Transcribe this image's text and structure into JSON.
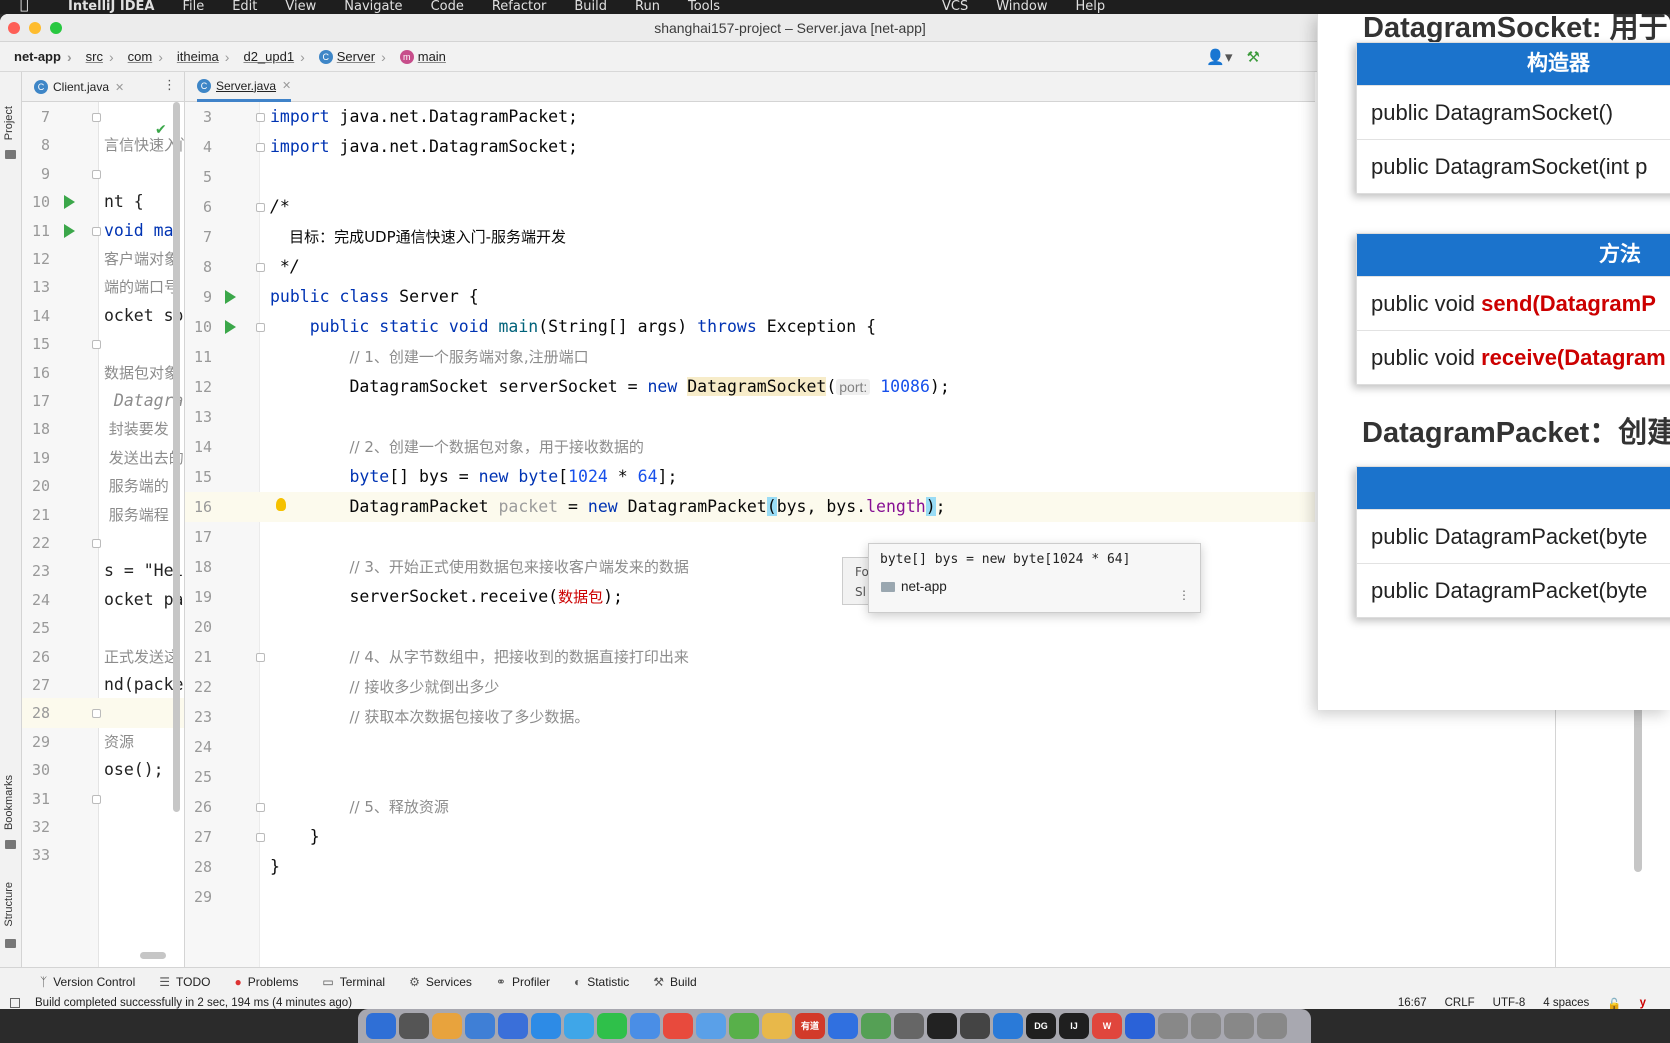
{
  "menubar": {
    "app_name": "IntelliJ IDEA",
    "items": [
      "File",
      "Edit",
      "View",
      "Navigate",
      "Code",
      "Refactor",
      "Build",
      "Run",
      "Tools",
      "VCS",
      "Window",
      "Help"
    ]
  },
  "window": {
    "title": "shanghai157-project – Server.java [net-app]"
  },
  "breadcrumbs": [
    {
      "label": "net-app",
      "icon": ""
    },
    {
      "label": "src",
      "icon": ""
    },
    {
      "label": "com",
      "icon": ""
    },
    {
      "label": "itheima",
      "icon": ""
    },
    {
      "label": "d2_upd1",
      "icon": ""
    },
    {
      "label": "Server",
      "icon": "class-icon"
    },
    {
      "label": "main",
      "icon": "method-icon"
    }
  ],
  "tool_stripe": {
    "project": "Project",
    "bookmarks": "Bookmarks",
    "structure": "Structure"
  },
  "tabs": {
    "left": {
      "label": "Client.java"
    },
    "right": {
      "label": "Server.java"
    }
  },
  "left_editor": {
    "lines": [
      {
        "n": "7",
        "code": ""
      },
      {
        "n": "8",
        "code": "言信快速入门"
      },
      {
        "n": "9",
        "code": ""
      },
      {
        "n": "10",
        "code": "nt {"
      },
      {
        "n": "11",
        "code": "void ma"
      },
      {
        "n": "12",
        "code": "客户端对象"
      },
      {
        "n": "13",
        "code": "端的端口号"
      },
      {
        "n": "14",
        "code": "ocket so"
      },
      {
        "n": "15",
        "code": ""
      },
      {
        "n": "16",
        "code": "数据包对象"
      },
      {
        "n": "17",
        "code": " Datagra"
      },
      {
        "n": "18",
        "code": " 封装要发"
      },
      {
        "n": "19",
        "code": " 发送出去的"
      },
      {
        "n": "20",
        "code": " 服务端的"
      },
      {
        "n": "21",
        "code": " 服务端程"
      },
      {
        "n": "22",
        "code": ""
      },
      {
        "n": "23",
        "code": "s = \"Hel"
      },
      {
        "n": "24",
        "code": "ocket pa"
      },
      {
        "n": "25",
        "code": ""
      },
      {
        "n": "26",
        "code": "正式发送这"
      },
      {
        "n": "27",
        "code": "nd(packe"
      },
      {
        "n": "28",
        "code": ""
      },
      {
        "n": "29",
        "code": "资源"
      },
      {
        "n": "30",
        "code": "ose();"
      },
      {
        "n": "31",
        "code": ""
      },
      {
        "n": "32",
        "code": ""
      },
      {
        "n": "33",
        "code": ""
      }
    ]
  },
  "right_editor": {
    "line_numbers": [
      "3",
      "4",
      "5",
      "6",
      "7",
      "8",
      "9",
      "10",
      "11",
      "12",
      "13",
      "14",
      "15",
      "16",
      "17",
      "18",
      "19",
      "20",
      "21",
      "22",
      "23",
      "24",
      "25",
      "26",
      "27",
      "28",
      "29"
    ],
    "l3": [
      "import",
      " java.net.DatagramPacket;"
    ],
    "l4": [
      "import",
      " java.net.DatagramSocket;"
    ],
    "l6": "/*",
    "l7": "    目标：完成UDP通信快速入门-服务端开发",
    "l8": " */",
    "l9": [
      "public class",
      " Server {"
    ],
    "l10": [
      "public static void",
      " main",
      "(String[] args) ",
      "throws",
      " Exception {"
    ],
    "l11": "// 1、创建一个服务端对象,注册端口",
    "l12": [
      "DatagramSocket serverSocket = ",
      "new",
      " ",
      "DatagramSocket",
      "(",
      "port:",
      " ",
      "10086",
      ");"
    ],
    "l14": "// 2、创建一个数据包对象，用于接收数据的",
    "l15": [
      "byte",
      "[] bys = ",
      "new",
      " ",
      "byte",
      "[",
      "1024",
      " * ",
      "64",
      "];"
    ],
    "l16": [
      "DatagramPacket ",
      "packet",
      " = ",
      "new",
      " DatagramPacket",
      "(",
      "bys, bys.",
      "length",
      ")",
      ";"
    ],
    "l18": "// 3、开始正式使用数据包来接收客户端发来的数据",
    "l19": [
      "serverSocket.receive(",
      "数据包",
      ");"
    ],
    "l21": "// 4、从字节数组中，把接收到的数据直接打印出来",
    "l22": "// 接收多少就倒出多少",
    "l23": "// 获取本次数据包接收了多少数据。",
    "l26": "// 5、释放资源",
    "l27": "}",
    "l28": "}"
  },
  "popup": {
    "behind_text": [
      "Fo",
      "Sl"
    ],
    "signature": "byte[] bys = new byte[1024 * 64]",
    "module": "net-app"
  },
  "toolwindows": [
    "Version Control",
    "TODO",
    "Problems",
    "Terminal",
    "Services",
    "Profiler",
    "Statistic",
    "Build"
  ],
  "statusbar": {
    "message": "Build completed successfully in 2 sec, 194 ms (4 minutes ago)",
    "position": "16:67",
    "line_sep": "CRLF",
    "encoding": "UTF-8",
    "indent": "4 spaces",
    "yarn": "y"
  },
  "overlay": {
    "heading1": "DatagramSocket: 用于",
    "card1": {
      "header": "构造器",
      "rows": [
        "public DatagramSocket()",
        "public DatagramSocket(int p"
      ]
    },
    "card2": {
      "header": "方法",
      "rows": [
        [
          "public void ",
          "send(DatagramP"
        ],
        [
          "public void ",
          "receive(Datagram"
        ]
      ]
    },
    "heading2": "DatagramPacket：创建",
    "card3": {
      "header": "",
      "rows": [
        "public DatagramPacket(byte",
        "public DatagramPacket(byte"
      ]
    }
  },
  "dock": {
    "colors": [
      "#2f6fd6",
      "#555",
      "#e8a33d",
      "#3f7fd6",
      "#3a6fd9",
      "#2d8be6",
      "#3fa6e8",
      "#2fc04a",
      "#4a8ee6",
      "#e84a3d",
      "#5aa0e8",
      "#58b04a",
      "#e8b84a",
      "#d23a2a",
      "#3070e0",
      "#55a055",
      "#666",
      "#222",
      "#444",
      "#2a7ad8",
      "#1f1f1f",
      "#1f1f1f",
      "#e0463c",
      "#2a62d8",
      "#888",
      "#888",
      "#888",
      "#888"
    ],
    "labels": [
      "",
      "",
      "",
      "",
      "",
      "",
      "",
      "",
      "",
      "",
      "",
      "",
      "",
      "有道",
      "",
      "",
      "",
      "",
      "",
      "",
      "DG",
      "IJ",
      "W",
      "",
      "",
      "",
      "",
      ""
    ]
  }
}
